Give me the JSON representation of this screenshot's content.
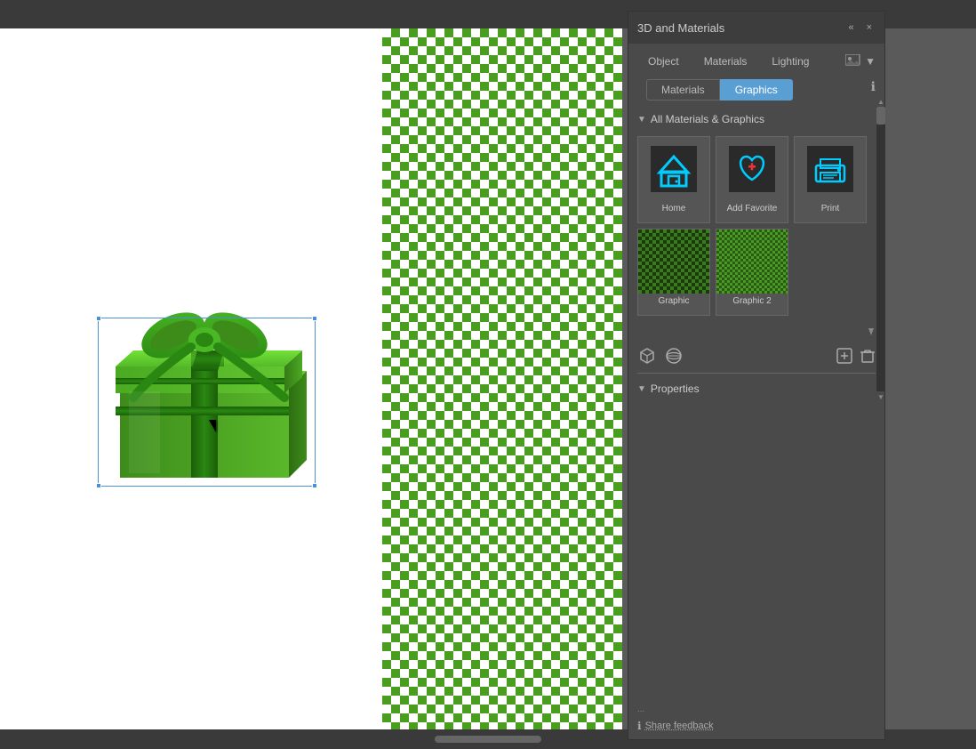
{
  "app": {
    "title": "3D and Materials"
  },
  "topbar": {},
  "panel": {
    "title": "3D and Materials",
    "collapse_label": "«",
    "close_label": "×",
    "tabs": [
      {
        "label": "Object",
        "active": false
      },
      {
        "label": "Materials",
        "active": false
      },
      {
        "label": "Lighting",
        "active": false
      }
    ],
    "sub_tabs": [
      {
        "label": "Materials",
        "active": false
      },
      {
        "label": "Graphics",
        "active": true
      }
    ],
    "section_all": "All Materials & Graphics",
    "grid_items_row1": [
      {
        "label": "Home",
        "icon_type": "home"
      },
      {
        "label": "Add Favorite",
        "icon_type": "favorite"
      },
      {
        "label": "Print",
        "icon_type": "print"
      }
    ],
    "grid_items_row2": [
      {
        "label": "Graphic",
        "icon_type": "graphic1"
      },
      {
        "label": "Graphic 2",
        "icon_type": "graphic2"
      }
    ],
    "properties_label": "Properties",
    "share_feedback_label": "Share feedback",
    "dots": "..."
  },
  "canvas": {
    "gift_box_alt": "3D Gift Box with green bow",
    "cursor_alt": "Mouse cursor"
  }
}
